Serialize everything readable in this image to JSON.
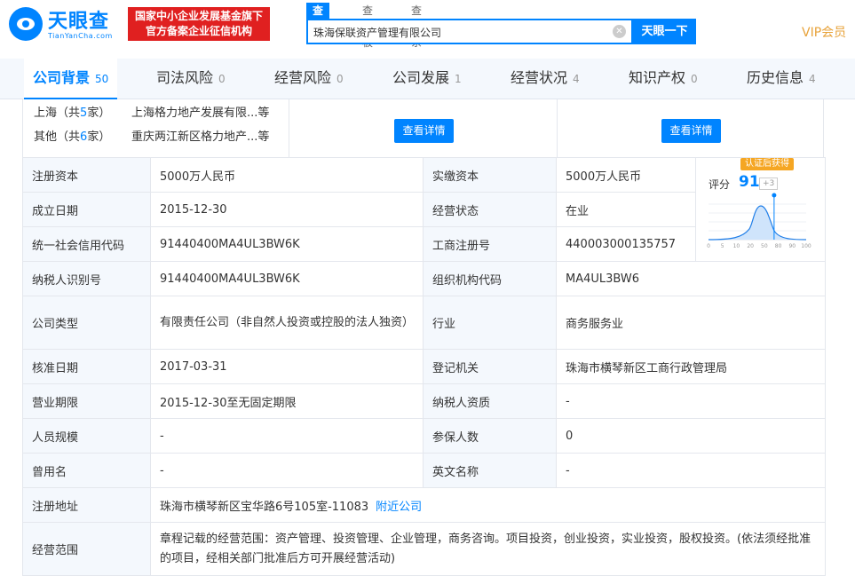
{
  "header": {
    "logo_text": "天眼查",
    "logo_sub": "TianYanCha.com",
    "badge_line1": "国家中小企业发展基金旗下",
    "badge_line2": "官方备案企业征信机构",
    "search_tabs": [
      "查公司",
      "查老板",
      "查关系"
    ],
    "search_value": "珠海保联资产管理有限公司",
    "search_button": "天眼一下",
    "vip": "VIP会员"
  },
  "tabs": [
    {
      "label": "公司背景",
      "count": "50"
    },
    {
      "label": "司法风险",
      "count": "0"
    },
    {
      "label": "经营风险",
      "count": "0"
    },
    {
      "label": "公司发展",
      "count": "1"
    },
    {
      "label": "经营状况",
      "count": "4"
    },
    {
      "label": "知识产权",
      "count": "0"
    },
    {
      "label": "历史信息",
      "count": "4"
    }
  ],
  "branches": [
    {
      "region": "上海",
      "pre": "（共",
      "num": "5",
      "post": "家）",
      "name": "上海格力地产发展有限...等"
    },
    {
      "region": "其他",
      "pre": "（共",
      "num": "6",
      "post": "家）",
      "name": "重庆两江新区格力地产...等"
    }
  ],
  "detail_button": "查看详情",
  "score": {
    "badge": "认证后获得",
    "label": "评分",
    "value": "91",
    "delta": "+3",
    "level": 0.91,
    "axis": [
      "0",
      "5",
      "10",
      "20",
      "50",
      "80",
      "90",
      "100"
    ]
  },
  "rows": [
    {
      "l1": "注册资本",
      "v1": "5000万人民币",
      "l2": "实缴资本",
      "v2": "5000万人民币"
    },
    {
      "l1": "成立日期",
      "v1": "2015-12-30",
      "l2": "经营状态",
      "v2": "在业"
    },
    {
      "l1": "统一社会信用代码",
      "v1": "91440400MA4UL3BW6K",
      "l2": "工商注册号",
      "v2": "440003000135757"
    },
    {
      "l1": "纳税人识别号",
      "v1": "91440400MA4UL3BW6K",
      "l2": "组织机构代码",
      "v2": "MA4UL3BW6"
    },
    {
      "l1": "公司类型",
      "v1": "有限责任公司（非自然人投资或控股的法人独资）",
      "l2": "行业",
      "v2": "商务服务业"
    },
    {
      "l1": "核准日期",
      "v1": "2017-03-31",
      "l2": "登记机关",
      "v2": "珠海市横琴新区工商行政管理局"
    },
    {
      "l1": "营业期限",
      "v1": "2015-12-30至无固定期限",
      "l2": "纳税人资质",
      "v2": "-"
    },
    {
      "l1": "人员规模",
      "v1": "-",
      "l2": "参保人数",
      "v2": "0"
    },
    {
      "l1": "曾用名",
      "v1": "-",
      "l2": "英文名称",
      "v2": "-"
    }
  ],
  "address": {
    "label": "注册地址",
    "value": "珠海市横琴新区宝华路6号105室-11083",
    "link": "附近公司"
  },
  "scope": {
    "label": "经营范围",
    "value": "章程记载的经营范围：资产管理、投资管理、企业管理，商务咨询。项目投资，创业投资，实业投资，股权投资。(依法须经批准的项目，经相关部门批准后方可开展经营活动)"
  }
}
